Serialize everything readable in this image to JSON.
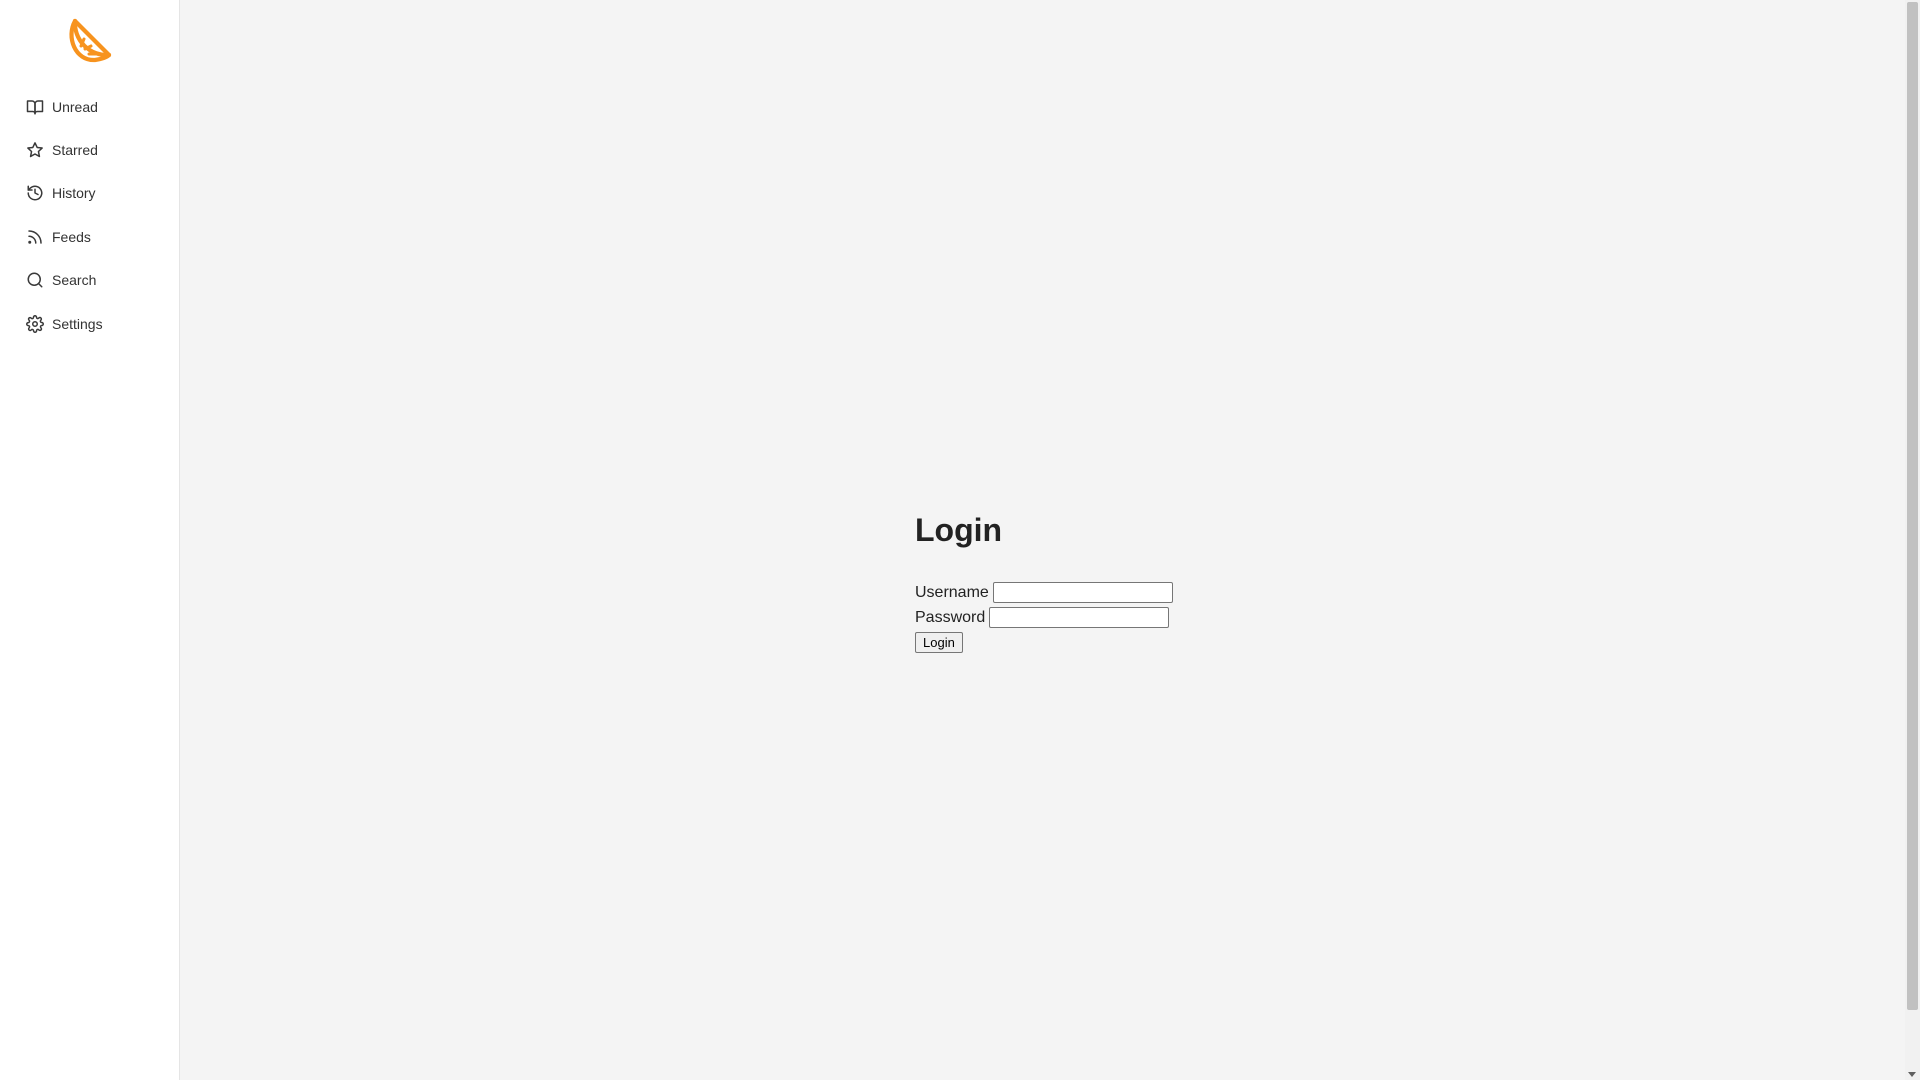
{
  "app": {
    "brand_color": "#f7931e"
  },
  "sidebar": {
    "logo_icon": "orange-slice-icon",
    "items": [
      {
        "label": "Unread",
        "icon": "book-open-icon"
      },
      {
        "label": "Starred",
        "icon": "star-icon"
      },
      {
        "label": "History",
        "icon": "history-icon"
      },
      {
        "label": "Feeds",
        "icon": "rss-icon"
      },
      {
        "label": "Search",
        "icon": "search-icon"
      },
      {
        "label": "Settings",
        "icon": "gear-icon"
      }
    ]
  },
  "login": {
    "title": "Login",
    "username_label": "Username",
    "username_value": "",
    "password_label": "Password",
    "password_value": "",
    "submit_label": "Login"
  }
}
